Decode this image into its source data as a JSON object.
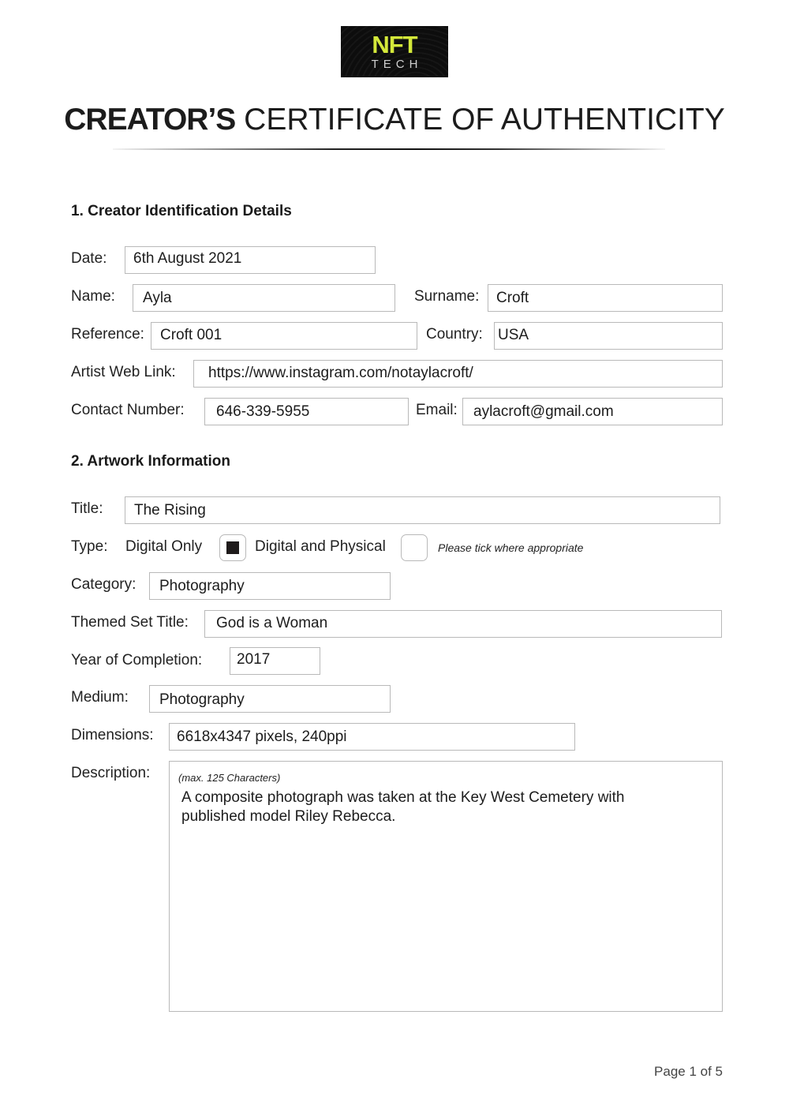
{
  "logo": {
    "primary": "NFT",
    "secondary": "TECH",
    "accent_color": "#d4e83a"
  },
  "header": {
    "title_bold": "CREATOR’S",
    "title_light": "CERTIFICATE OF AUTHENTICITY"
  },
  "section1": {
    "heading": "1. Creator Identification Details",
    "fields": {
      "date": {
        "label": "Date:",
        "value": "6th August 2021"
      },
      "name": {
        "label": "Name:",
        "value": "Ayla"
      },
      "surname": {
        "label": "Surname:",
        "value": "Croft"
      },
      "reference": {
        "label": "Reference:",
        "value": "Croft 001"
      },
      "country": {
        "label": "Country:",
        "value": "USA"
      },
      "web_link": {
        "label": "Artist Web Link:",
        "value": "https://www.instagram.com/notaylacroft/"
      },
      "contact": {
        "label": "Contact Number:",
        "value": "646-339-5955"
      },
      "email": {
        "label": "Email:",
        "value": "aylacroft@gmail.com"
      }
    }
  },
  "section2": {
    "heading": "2. Artwork Information",
    "fields": {
      "title": {
        "label": "Title:",
        "value": "The Rising"
      },
      "type": {
        "label": "Type:",
        "options": [
          {
            "label": "Digital Only",
            "checked": true
          },
          {
            "label": "Digital and Physical",
            "checked": false
          }
        ],
        "hint": "Please tick where appropriate"
      },
      "category": {
        "label": "Category:",
        "value": "Photography"
      },
      "themed_set": {
        "label": "Themed Set Title:",
        "value": "God is a Woman"
      },
      "year": {
        "label": "Year of Completion:",
        "value": "2017"
      },
      "medium": {
        "label": "Medium:",
        "value": "Photography"
      },
      "dimensions": {
        "label": "Dimensions:",
        "value": "6618x4347 pixels, 240ppi"
      },
      "description": {
        "label": "Description:",
        "hint": "(max. 125 Characters)",
        "value": "A composite photograph was taken at the Key West Cemetery with published model Riley Rebecca."
      }
    }
  },
  "footer": {
    "page_label": "Page 1 of 5"
  }
}
